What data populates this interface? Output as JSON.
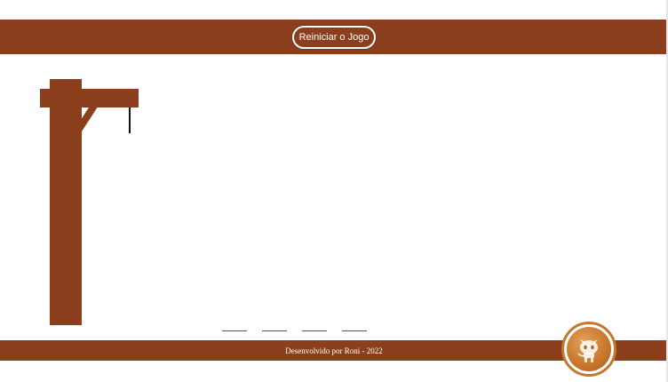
{
  "header": {
    "restart_label": "Reiniciar o Jogo"
  },
  "game": {
    "letter_slots": [
      "",
      "",
      "",
      ""
    ]
  },
  "footer": {
    "credit": "Desenvolvido por Roni - 2022"
  },
  "icons": {
    "github": "github-octocat-icon"
  },
  "colors": {
    "brand": "#8b3f1c",
    "github_ring": "#c2782f",
    "rope": "#111111"
  }
}
